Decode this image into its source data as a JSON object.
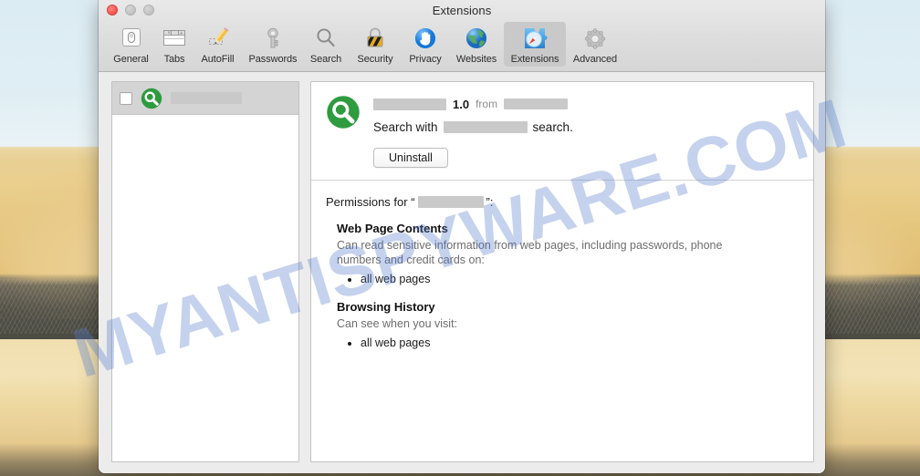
{
  "desktop": {
    "watermark": "MYANTISPYWARE.COM"
  },
  "window": {
    "title": "Extensions",
    "traffic_lights": [
      {
        "name": "close",
        "color": "#fc5753"
      },
      {
        "name": "minimize",
        "color": "#c4c4c4"
      },
      {
        "name": "zoom",
        "color": "#c4c4c4"
      }
    ]
  },
  "toolbar": {
    "tabs": [
      {
        "label": "General",
        "icon": "general-icon",
        "selected": false
      },
      {
        "label": "Tabs",
        "icon": "tabs-icon",
        "selected": false
      },
      {
        "label": "AutoFill",
        "icon": "autofill-icon",
        "selected": false
      },
      {
        "label": "Passwords",
        "icon": "passwords-icon",
        "selected": false
      },
      {
        "label": "Search",
        "icon": "search-icon",
        "selected": false
      },
      {
        "label": "Security",
        "icon": "security-icon",
        "selected": false
      },
      {
        "label": "Privacy",
        "icon": "privacy-icon",
        "selected": false
      },
      {
        "label": "Websites",
        "icon": "websites-icon",
        "selected": false
      },
      {
        "label": "Extensions",
        "icon": "extensions-icon",
        "selected": true
      },
      {
        "label": "Advanced",
        "icon": "advanced-icon",
        "selected": false
      }
    ]
  },
  "sidebar": {
    "items": [
      {
        "icon": "green-magnifier-icon",
        "name_redacted": true,
        "name_width": 78,
        "checked": false,
        "selected": true
      }
    ]
  },
  "detail": {
    "icon": "green-magnifier-icon",
    "name_redacted": true,
    "name_width": 80,
    "version": "1.0",
    "from_label": "from",
    "publisher_redacted": true,
    "publisher_width": 70,
    "description_prefix": "Search with",
    "description_redacted": true,
    "description_width": 92,
    "description_suffix": "search.",
    "uninstall_label": "Uninstall",
    "permissions": {
      "heading_prefix": "Permissions for “",
      "heading_redacted": true,
      "heading_width": 72,
      "heading_suffix": "”:",
      "groups": [
        {
          "title": "Web Page Contents",
          "description": "Can read sensitive information from web pages, including passwords, phone numbers and credit cards on:",
          "items": [
            "all web pages"
          ]
        },
        {
          "title": "Browsing History",
          "description": "Can see when you visit:",
          "items": [
            "all web pages"
          ]
        }
      ]
    }
  },
  "colors": {
    "extension_icon_green": "#2e9b3f",
    "selected_tab_bg": "#c9c9c9",
    "watermark_blue": "#567ccd"
  }
}
